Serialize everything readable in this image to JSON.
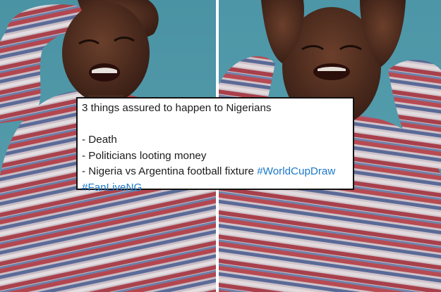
{
  "meme": {
    "left_photo": "crying-child-holding-head",
    "right_photo": "crying-child-hands-on-face"
  },
  "tweet": {
    "headline": "3 things assured to happen to Nigerians",
    "items": [
      "- Death",
      "- Politicians looting money",
      "- Nigeria vs Argentina football fixture"
    ],
    "hashtags": [
      "#WorldCupDraw",
      "#FanLiveNG"
    ]
  },
  "colors": {
    "background_teal": "#4f98a8",
    "skin": "#4a2a1e",
    "shirt_stripe_red": "#b64a52",
    "shirt_stripe_blue": "#5a6d9a",
    "shirt_stripe_white": "#d9d3d6",
    "hashtag": "#1b78c9",
    "tweet_border": "#111111"
  }
}
